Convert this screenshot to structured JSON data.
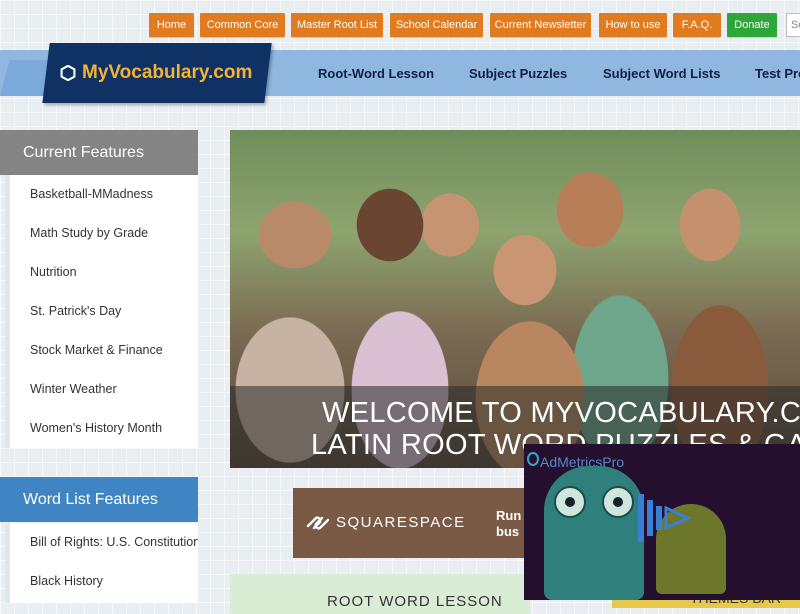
{
  "top_nav": [
    "Home",
    "Common Core",
    "Master Root List",
    "School Calendar",
    "Current Newsletter",
    "How to use",
    "F.A.Q."
  ],
  "donate_label": "Donate",
  "search_placeholder": "Se",
  "logo_text": "MyVocabulary.com",
  "main_nav": [
    "Root-Word Lesson",
    "Subject Puzzles",
    "Subject Word Lists",
    "Test Pre"
  ],
  "current_features": {
    "title": "Current Features",
    "items": [
      "Basketball-MMadness",
      "Math Study by Grade",
      "Nutrition",
      "St. Patrick's Day",
      "Stock Market & Finance",
      "Winter Weather",
      "Women's History Month"
    ]
  },
  "word_list_features": {
    "title": "Word List Features",
    "items": [
      "Bill of Rights: U.S. Constitution",
      "Black History"
    ]
  },
  "hero": {
    "line1": "WELCOME TO MYVOCABULARY.CO",
    "line2": "LATIN ROOT WORD PUZZLES & GAM"
  },
  "squarespace_ad": {
    "brand": "SQUARESPACE",
    "tagline_1": "Run",
    "tagline_2": "bus"
  },
  "admetrics": {
    "label": "AdMetricsPro"
  },
  "bottom_card_text": "ROOT WORD LESSON",
  "bottom_right_text": "THEMES BAR",
  "colors": {
    "nav_orange": "#e07b1f",
    "donate_green": "#2ea63a",
    "logo_navy": "#0f3164",
    "logo_gold": "#f5b335",
    "band_blue": "#8fb7e0",
    "panel_gray": "#848484",
    "panel_blue": "#3f85c4"
  }
}
